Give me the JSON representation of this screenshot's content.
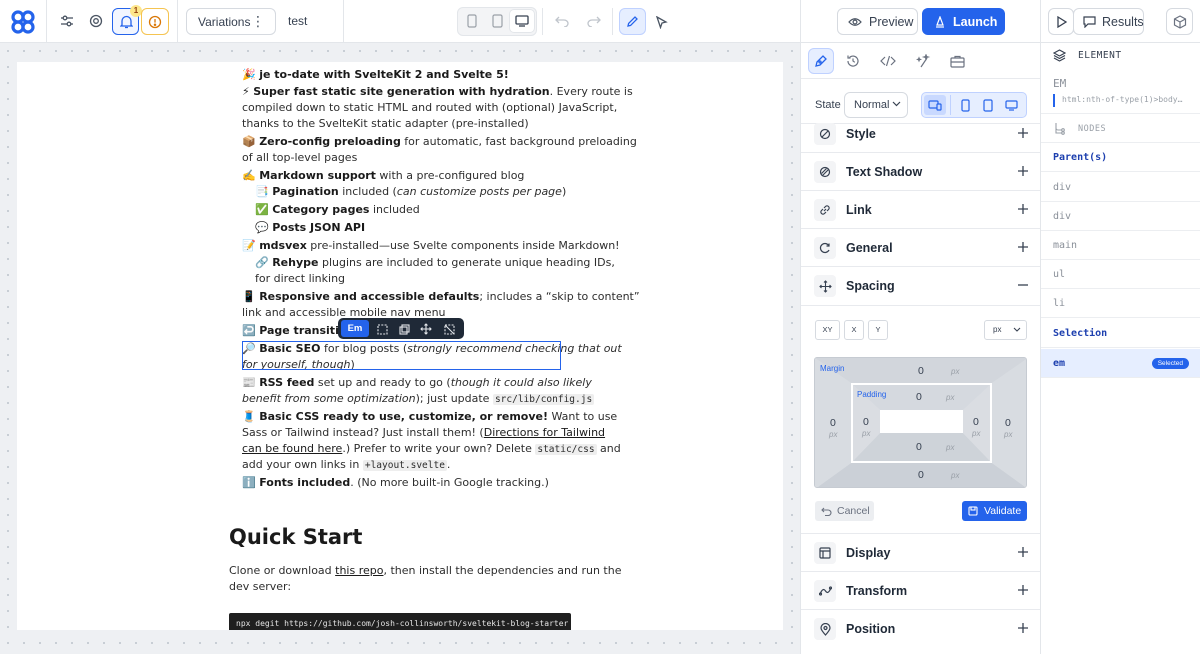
{
  "topbar": {
    "notification_count": "1",
    "variations_label": "Variations",
    "variation_name": "test",
    "preview_label": "Preview",
    "launch_label": "Launch",
    "results_label": "Results"
  },
  "page": {
    "lines": [
      {
        "pre": "🎉 ",
        "b": "je to-date with SvelteKit 2 and Svelte 5!",
        "post": ""
      },
      {
        "pre": "⚡ ",
        "b": "Super fast static site generation with hydration",
        "post": ". Every route is"
      },
      {
        "pre": "compiled down to static HTML and routed with (optional) JavaScript,",
        "b": "",
        "post": ""
      },
      {
        "pre": "thanks to the SvelteKit static adapter (pre-installed)",
        "b": "",
        "post": ""
      },
      {
        "pre": "📦 ",
        "b": "Zero-config preloading",
        "post": " for automatic, fast background preloading"
      },
      {
        "pre": "of all top-level pages",
        "b": "",
        "post": ""
      },
      {
        "pre": "✍️ ",
        "b": "Markdown support",
        "post": " with a pre-configured blog"
      },
      {
        "pre": "📑 ",
        "b": "Pagination",
        "post": " included (can customize posts per page)",
        "indent": true
      },
      {
        "pre": "✅ ",
        "b": "Category pages",
        "post": " included",
        "indent": true
      },
      {
        "pre": "💬 ",
        "b": "Posts JSON API",
        "post": "",
        "indent": true
      },
      {
        "pre": "📝 ",
        "b": "mdsvex",
        "post": " pre-installed—use Svelte components inside Markdown!"
      },
      {
        "pre": "🔗 ",
        "b": "Rehype",
        "post": " plugins are included to generate unique heading IDs,",
        "indent": true
      },
      {
        "pre": "for direct linking",
        "b": "",
        "post": "",
        "indent": true
      },
      {
        "pre": "📱 ",
        "b": "Responsive and accessible defaults",
        "post": "; includes a “skip to content”"
      },
      {
        "pre": "link and accessible mobile nav menu",
        "b": "",
        "post": ""
      },
      {
        "pre": "↩️ ",
        "b": "Page transitions",
        "post": ""
      },
      {
        "pre": "🔎 ",
        "b": "Basic SEO",
        "post": " for blog posts (strongly recommend checking that out"
      },
      {
        "pre": "for yourself, though)",
        "b": "",
        "post": ""
      },
      {
        "pre": "📰 ",
        "b": "RSS feed",
        "post": " set up and ready to go (though it could also likely"
      },
      {
        "pre": "benefit from some optimization); just update ",
        "b": "",
        "post": "",
        "code": "src/lib/config.js"
      },
      {
        "pre": "🧵 ",
        "b": "Basic CSS ready to use, customize, or remove!",
        "post": " Want to use"
      },
      {
        "pre": "Sass or Tailwind instead? Just install them! (",
        "b": "",
        "post": "",
        "link": "Directions for Tailwind"
      },
      {
        "pre": "",
        "b": "",
        "post": ".) Prefer to write your own? Delete ",
        "link": "can be found here",
        "code": "static/css",
        "tail": " and"
      },
      {
        "pre": "add your own links in ",
        "b": "",
        "post": ".",
        "code": "+layout.svelte"
      },
      {
        "pre": "ℹ️ ",
        "b": "Fonts included",
        "post": ". (No more built-in Google tracking.)"
      }
    ],
    "heading": "Quick Start",
    "para_pre": "Clone or download ",
    "para_link": "this repo",
    "para_post": ", then install the dependencies and run the",
    "para_line2": "dev server:",
    "code_block": "npx degit https://github.com/josh-collinsworth/sveltekit-blog-starter my-sveltekit-blog"
  },
  "floating_toolbar": {
    "tag": "Em"
  },
  "panel": {
    "state_label": "State",
    "state_value": "Normal",
    "sections": [
      {
        "label": "Style",
        "icon": "style-icon"
      },
      {
        "label": "Text Shadow",
        "icon": "text-shadow-icon"
      },
      {
        "label": "Link",
        "icon": "link-icon"
      },
      {
        "label": "General",
        "icon": "general-icon"
      },
      {
        "label": "Spacing",
        "icon": "spacing-icon"
      }
    ],
    "spacing": {
      "xy": "XY",
      "x": "X",
      "y": "Y",
      "unit": "px",
      "margin_label": "Margin",
      "padding_label": "Padding",
      "margin": {
        "top": "0",
        "right": "0",
        "bottom": "0",
        "left": "0"
      },
      "padding": {
        "top": "0",
        "right": "0",
        "bottom": "0",
        "left": "0"
      },
      "px": "px",
      "cancel": "Cancel",
      "validate": "Validate"
    },
    "sections_bottom": [
      {
        "label": "Display",
        "icon": "display-icon"
      },
      {
        "label": "Transform",
        "icon": "transform-icon"
      },
      {
        "label": "Position",
        "icon": "position-icon"
      }
    ]
  },
  "nodes": {
    "element_header": "ELEMENT",
    "element_tag": "EM",
    "selector": "html:nth-of-type(1)>body…",
    "nodes_header": "NODES",
    "parents_label": "Parent(s)",
    "parents": [
      "div",
      "div",
      "main",
      "ul",
      "li"
    ],
    "selection_label": "Selection",
    "selected_tag": "em",
    "selected_badge": "Selected"
  },
  "colors": {
    "accent": "#2463eb",
    "accent_light": "#e6eeff",
    "warning": "#f59e0b"
  }
}
